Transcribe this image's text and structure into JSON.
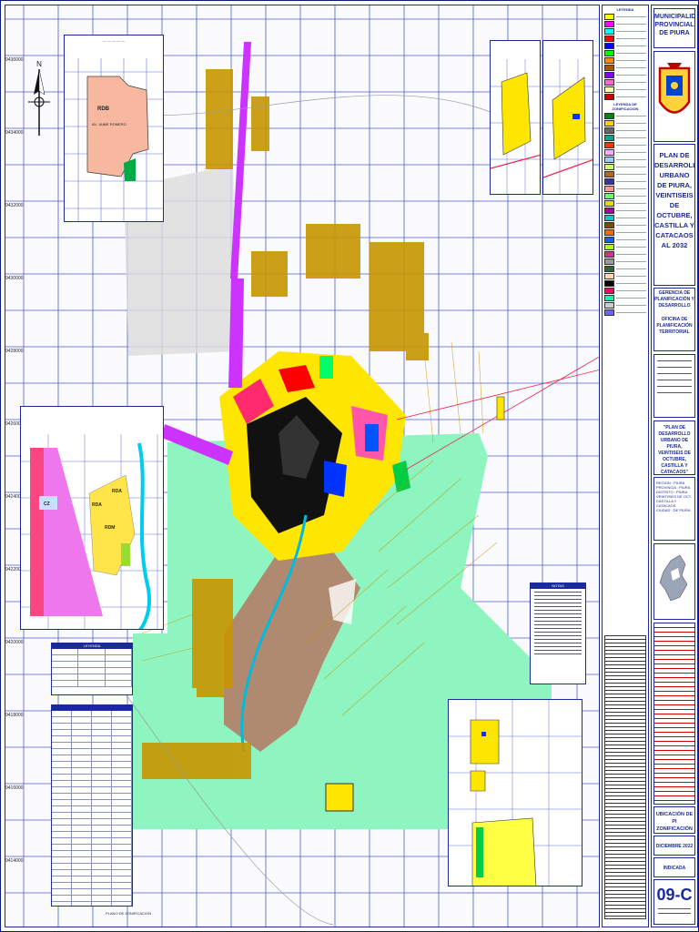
{
  "header": {
    "entity": "MUNICIPALIDAD PROVINCIAL DE PIURA",
    "plan_title": "PLAN DE DESARROLLO URBANO DE PIURA, VEINTISEIS DE OCTUBRE, CASTILLA Y CATACAOS AL 2032"
  },
  "office": {
    "gerencia": "GERENCIA DE PLANIFICACIÓN Y DESARROLLO",
    "oficina": "OFICINA DE PLANIFICACIÓN TERRITORIAL"
  },
  "project_name": "\"PLAN DE DESARROLLO URBANO DE PIURA, VEINTISEIS DE OCTUBRE, CASTILLA Y CATACAOS\"",
  "location": {
    "region_label": "REGION",
    "region": "PIURA",
    "provincia_label": "PROVINCIA",
    "provincia": "PIURA",
    "distrito_label": "DISTRITO",
    "distrito": "PIURA VEINTISEIS DE OCT. CASTILLA Y CATACAOS",
    "ciudad_label": "CIUDAD",
    "ciudad": "DE PIURA"
  },
  "sheet": {
    "subject": "UBICACIÓN DE PI ZONIFICACIÓN",
    "date": "DICIEMBRE 2022",
    "scale": "INDICADA",
    "number": "09-C"
  },
  "legend": {
    "title": "LEYENDA",
    "zonification_title": "LEYENDA DE ZONIFICACION",
    "swatches": [
      "#ffff00",
      "#ff00ff",
      "#00ffff",
      "#ff0000",
      "#0000ff",
      "#00ff00",
      "#ff8800",
      "#aa5500",
      "#8800ff",
      "#ff66cc",
      "#ffffaa",
      "#cc0000",
      "#008800",
      "#ffcc00",
      "#666666",
      "#00aa88",
      "#ff3300",
      "#ffaaff",
      "#99ccff",
      "#ccff66",
      "#b5651d",
      "#3333aa",
      "#ff9999",
      "#66ff66",
      "#dddd00",
      "#aa00aa",
      "#00cccc",
      "#884400",
      "#ff6600",
      "#0066ff",
      "#aaff00",
      "#cc3399",
      "#999999",
      "#336633",
      "#ffddaa",
      "#000000",
      "#ff0066",
      "#00ffaa",
      "#cccccc",
      "#6666ff"
    ]
  },
  "insets": {
    "top_left": {
      "zone": "RDB",
      "label": "AV. JAIME ROMERO"
    },
    "left": {
      "zones": [
        "RDA",
        "RDM",
        "CZ",
        "RDA"
      ]
    },
    "plano": "PLANO DE ZONIFICACION"
  },
  "map_labels": {
    "coords_left": [
      "9436000",
      "9434000",
      "9432000",
      "9430000",
      "9428000",
      "9426000",
      "9424000",
      "9422000",
      "9420000",
      "9418000",
      "9416000",
      "9414000"
    ],
    "notes_title": "NOTAS"
  },
  "colors": {
    "border": "#1b2a9a",
    "green_zone": "#8ff5c0",
    "urban_brown": "#c89600",
    "magenta": "#cc33ff"
  }
}
